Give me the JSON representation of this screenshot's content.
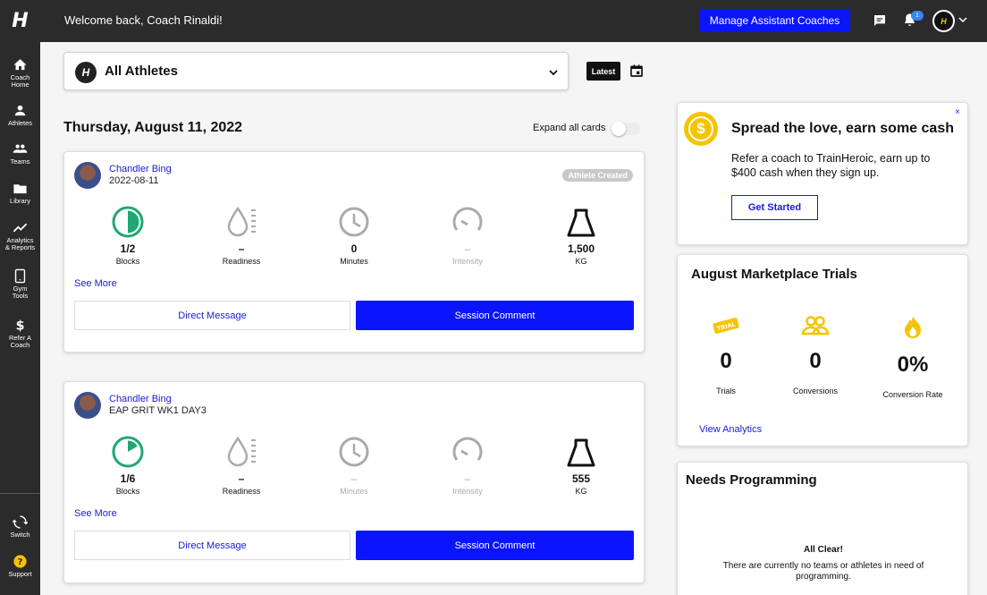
{
  "app": {
    "logo": "H"
  },
  "topbar": {
    "welcome": "Welcome back, Coach Rinaldi!",
    "manage_btn": "Manage Assistant Coaches",
    "notif_count": "1"
  },
  "sidebar": {
    "items": [
      {
        "label": "Coach\nHome",
        "icon": "home-icon"
      },
      {
        "label": "Athletes",
        "icon": "person-icon"
      },
      {
        "label": "Teams",
        "icon": "group-icon"
      },
      {
        "label": "Library",
        "icon": "folder-icon"
      },
      {
        "label": "Analytics\n& Reports",
        "icon": "chart-icon"
      },
      {
        "label": "Gym\nTools",
        "icon": "tablet-icon"
      },
      {
        "label": "Refer A\nCoach",
        "icon": "dollar-icon"
      },
      {
        "label": "Switch",
        "icon": "switch-icon"
      },
      {
        "label": "Support",
        "icon": "help-icon"
      }
    ]
  },
  "filter": {
    "athlete_select": "All Athletes",
    "latest_btn": "Latest"
  },
  "feed": {
    "date": "Thursday, August 11, 2022",
    "expand_label": "Expand all cards"
  },
  "cards": [
    {
      "athlete": "Chandler Bing",
      "subtitle": "2022-08-11",
      "badge": "Athlete Created",
      "metrics": [
        {
          "value": "1/2",
          "label": "Blocks",
          "fraction": 0.5
        },
        {
          "value": "–",
          "label": "Readiness"
        },
        {
          "value": "0",
          "label": "Minutes"
        },
        {
          "value": "–",
          "label": "Intensity"
        },
        {
          "value": "1,500",
          "label": "KG"
        }
      ],
      "see_more": "See More",
      "dm": "Direct Message",
      "comment": "Session Comment"
    },
    {
      "athlete": "Chandler Bing",
      "subtitle": "EAP GRIT WK1 DAY3",
      "metrics": [
        {
          "value": "1/6",
          "label": "Blocks",
          "fraction": 0.1667
        },
        {
          "value": "–",
          "label": "Readiness"
        },
        {
          "value": "–",
          "label": "Minutes"
        },
        {
          "value": "–",
          "label": "Intensity"
        },
        {
          "value": "555",
          "label": "KG"
        }
      ],
      "see_more": "See More",
      "dm": "Direct Message",
      "comment": "Session Comment"
    }
  ],
  "promo": {
    "title": "Spread the love, earn some cash",
    "body": "Refer a coach to TrainHeroic, earn up to $400 cash when they sign up.",
    "cta": "Get Started",
    "close": "×",
    "coin": "$"
  },
  "marketplace": {
    "title": "August Marketplace Trials",
    "trial_tag": "TRIAL",
    "stats": [
      {
        "value": "0",
        "label": "Trials"
      },
      {
        "value": "0",
        "label": "Conversions"
      },
      {
        "value": "0%",
        "label": "Conversion Rate"
      }
    ],
    "link": "View Analytics"
  },
  "needs": {
    "title": "Needs Programming",
    "heading": "All Clear!",
    "text": "There are currently no teams or athletes in need of programming."
  },
  "colors": {
    "accent": "#0a14ff",
    "link": "#1a1adb",
    "gold": "#f5c400",
    "dark": "#2b2b2b",
    "green": "#1fa774"
  }
}
